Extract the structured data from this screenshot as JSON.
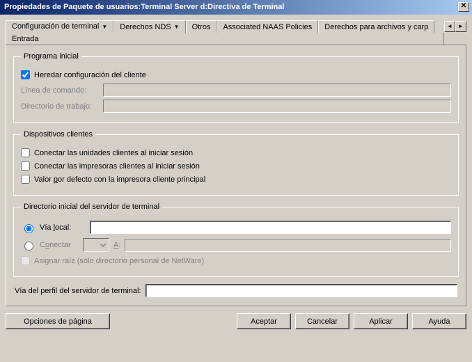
{
  "title": "Propiedades de Paquete de usuarios:Terminal Server d:Directiva de Terminal",
  "tabs": {
    "config": "Configuración de terminal",
    "nds": "Derechos NDS",
    "otros": "Otros",
    "naas": "Associated NAAS Policies",
    "archivos": "Derechos para archivos y carp",
    "entrada": "Entrada"
  },
  "group1": {
    "legend": "Programa inicial",
    "inherit": "Heredar configuración del cliente",
    "cmdline": "Línea de comando:",
    "workdir": "Directorio de trabajo:"
  },
  "group2": {
    "legend": "Dispositivos clientes",
    "drives": "Conectar las unidades clientes al iniciar sesión",
    "printers": "Conectar las impresoras clientes al iniciar sesión",
    "defprinter_pre": "Valor ",
    "defprinter_u": "p",
    "defprinter_post": "or defecto con la impresora cliente principal"
  },
  "group3": {
    "legend": "Directorio inicial del servidor de terminal",
    "local_pre": "Vía ",
    "local_u": "l",
    "local_post": "ocal:",
    "connect_pre": "C",
    "connect_u": "o",
    "connect_post": "nectar",
    "driveletter": "A",
    "maproot": "Asignar raíz (sólo directorio personal de NetWare)"
  },
  "profile_label": "Vía del perfil del servidor de terminal:",
  "buttons": {
    "pageopts": "Opciones de página",
    "ok": "Aceptar",
    "cancel": "Cancelar",
    "apply": "Aplicar",
    "help": "Ayuda"
  }
}
